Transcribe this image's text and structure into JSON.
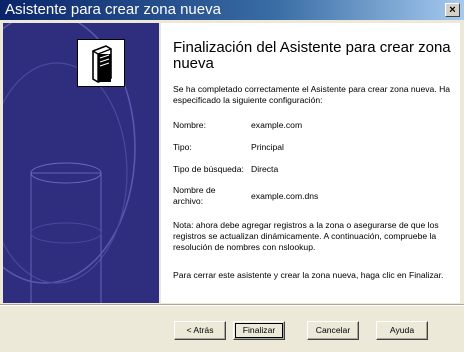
{
  "window": {
    "title": "Asistente para crear zona nueva",
    "close_glyph": "×"
  },
  "content": {
    "heading": "Finalización del Asistente para crear zona nueva",
    "intro": "Se ha completado correctamente el Asistente para crear zona nueva. Ha especificado la siguiente configuración:",
    "fields": [
      {
        "label": "Nombre:",
        "value": "example.com"
      },
      {
        "label": "Tipo:",
        "value": "Principal"
      },
      {
        "label": "Tipo de búsqueda:",
        "value": "Directa"
      },
      {
        "label": "Nombre de archivo:",
        "value": "example.com.dns"
      }
    ],
    "note": "Nota: ahora debe agregar registros a la zona o asegurarse de que los registros se actualizan dinámicamente. A continuación, compruebe la resolución de nombres con nslookup.",
    "closing": "Para cerrar este asistente y crear la zona nueva, haga clic en Finalizar."
  },
  "buttons": {
    "back": "< Atrás",
    "finish": "Finalizar",
    "cancel": "Cancelar",
    "help": "Ayuda"
  },
  "colors": {
    "side_panel": "#2e2d7e",
    "title_bar": "#0a246a",
    "dialog_bg": "#ece9d8"
  },
  "icons": {
    "wizard_icon": "server-document-icon"
  }
}
